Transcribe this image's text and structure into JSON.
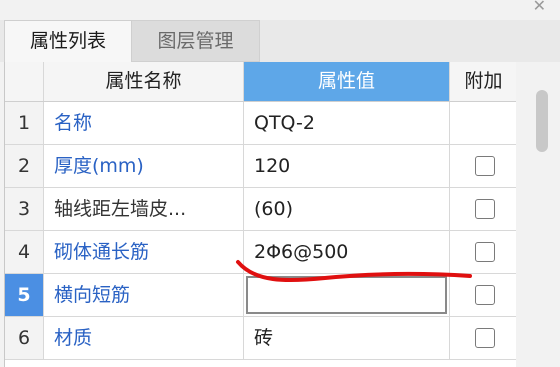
{
  "window": {
    "close_icon": "close-icon"
  },
  "tabs": [
    {
      "label": "属性列表",
      "active": true
    },
    {
      "label": "图层管理",
      "active": false
    }
  ],
  "table": {
    "columns": [
      "属性名称",
      "属性值",
      "附加"
    ],
    "rows": [
      {
        "index": "1",
        "name": "名称",
        "value": "QTQ-2",
        "has_checkbox": false,
        "checked": false,
        "name_color": "link"
      },
      {
        "index": "2",
        "name": "厚度(mm)",
        "value": "120",
        "has_checkbox": true,
        "checked": false,
        "name_color": "link"
      },
      {
        "index": "3",
        "name": "轴线距左墙皮...",
        "value": "(60)",
        "has_checkbox": true,
        "checked": false,
        "name_color": "plain"
      },
      {
        "index": "4",
        "name": "砌体通长筋",
        "value": "2Φ6@500",
        "has_checkbox": true,
        "checked": false,
        "name_color": "link"
      },
      {
        "index": "5",
        "name": "横向短筋",
        "value": "",
        "has_checkbox": true,
        "checked": false,
        "name_color": "link",
        "selected": true
      },
      {
        "index": "6",
        "name": "材质",
        "value": "砖",
        "has_checkbox": true,
        "checked": false,
        "name_color": "link"
      }
    ]
  },
  "colors": {
    "selected_header": "#5ea7e8",
    "selected_row_index": "#4b8fe3",
    "link_text": "#2a62c4",
    "annotation_stroke": "#e01010"
  }
}
